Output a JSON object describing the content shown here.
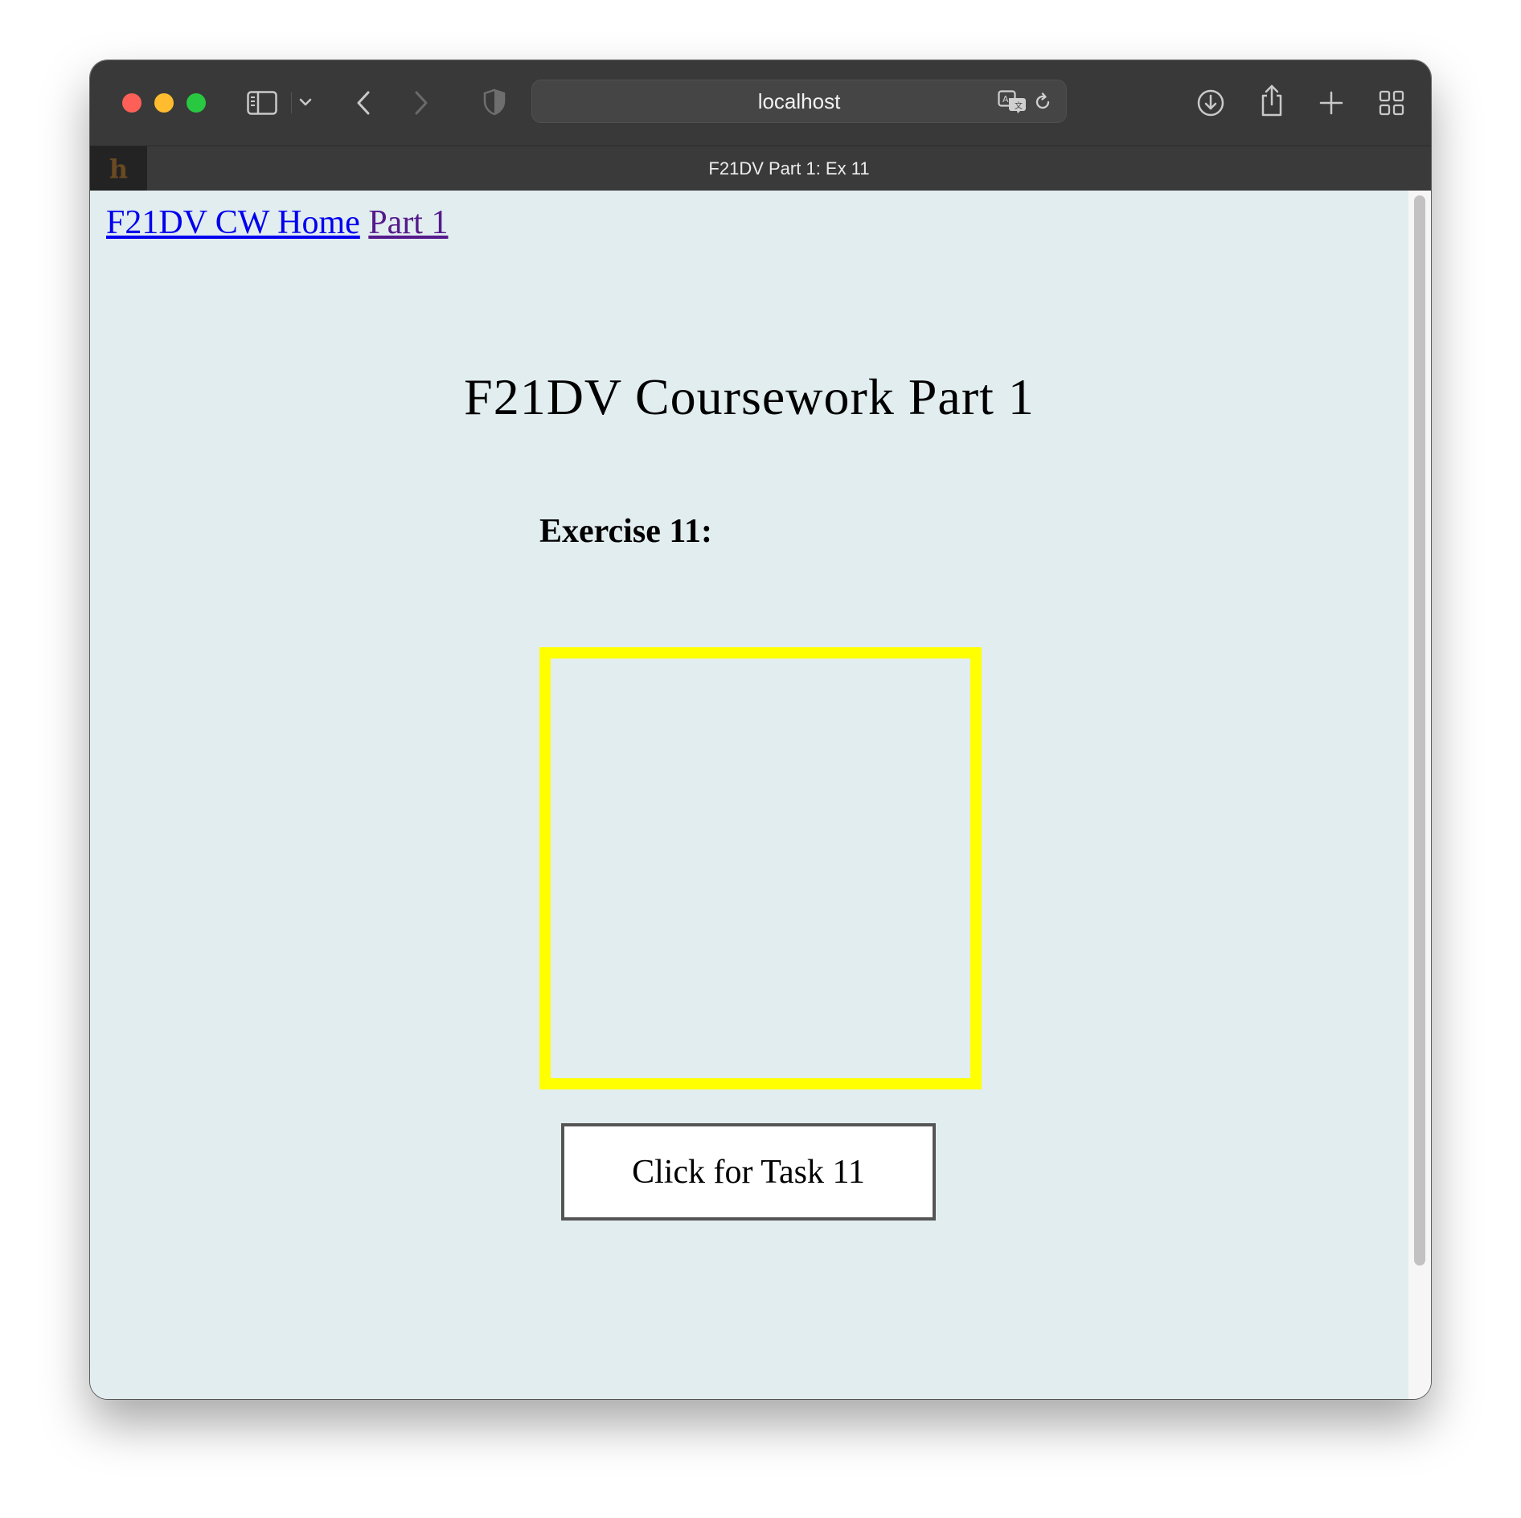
{
  "browser": {
    "url": "localhost",
    "tab_title": "F21DV Part 1: Ex 11",
    "favicon_letter": "h",
    "icons": {
      "sidebar": "sidebar-icon",
      "sidebar_menu": "chevron-down-icon",
      "back": "chevron-left-icon",
      "forward": "chevron-right-icon",
      "privacy": "shield-icon",
      "translate": "translate-icon",
      "reload": "reload-icon",
      "downloads": "download-icon",
      "share": "share-icon",
      "new_tab": "plus-icon",
      "tab_overview": "grid-icon"
    }
  },
  "nav": {
    "home_link": "F21DV CW Home",
    "part_link": "Part 1"
  },
  "page": {
    "title": "F21DV Coursework Part 1",
    "exercise_heading": "Exercise 11:",
    "button_label": "Click for Task 11"
  },
  "colors": {
    "page_background": "#e2edef",
    "box_border": "#ffff00",
    "link": "#0000ee",
    "visited_link": "#551a8b"
  }
}
